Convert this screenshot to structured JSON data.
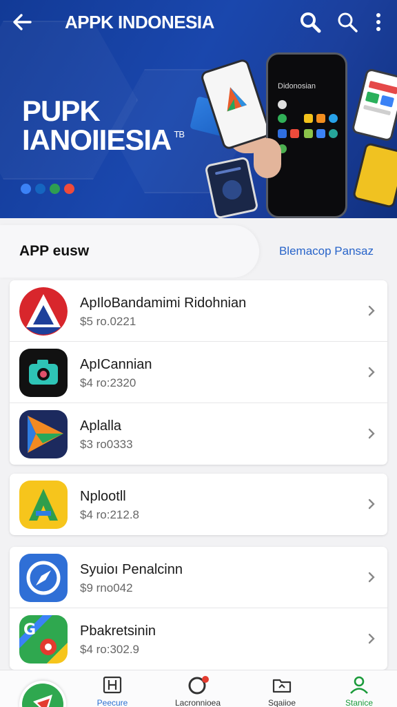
{
  "header": {
    "title": "APPK INDONESIA",
    "back_icon": "arrow-left-icon",
    "actions": [
      "search-icon",
      "search-icon",
      "more-vert-icon"
    ]
  },
  "banner": {
    "brand_line1": "PUPK",
    "brand_line2": "IANOIIESIA",
    "brand_mark": "TB",
    "phone_screen_title": "Didonosian",
    "dots": [
      "#3b82f6",
      "#1565c0",
      "#2e9e52",
      "#ee4b3b"
    ]
  },
  "section": {
    "title": "APP eusw",
    "link": "Blemacop Pansaz"
  },
  "apps": [
    [
      {
        "name": "ApIloBandamimi Ridohnian",
        "price": "$5 ro.0221",
        "icon": "red-triangle-icon"
      },
      {
        "name": "ApICannian",
        "price": "$4 ro:2320",
        "icon": "camera-icon"
      },
      {
        "name": "Aplalla",
        "price": "$3 ro0333",
        "icon": "paper-plane-icon"
      }
    ],
    [
      {
        "name": "Nplootll",
        "price": "$4 ro:212.8",
        "icon": "letter-a-icon"
      }
    ],
    [
      {
        "name": "Syuioı Penalcinn",
        "price": "$9 rno042",
        "icon": "compass-icon"
      },
      {
        "name": "Pbakretsinin",
        "price": "$4 ro:302.9",
        "icon": "maps-pin-icon"
      }
    ]
  ],
  "bottom_nav": [
    {
      "label": "Peecure",
      "icon": "grid-icon",
      "color": "#2c6fd0"
    },
    {
      "label": "Lacronnioea",
      "icon": "notification-icon",
      "color": "#333333"
    },
    {
      "label": "Sqaiioe",
      "icon": "folder-icon",
      "color": "#333333"
    },
    {
      "label": "Stanice",
      "icon": "person-icon",
      "color": "#1a9a3a"
    }
  ],
  "colors": {
    "banner_blue": "#1a47ad",
    "link_blue": "#2864c9",
    "active_green": "#1a9a3a"
  }
}
